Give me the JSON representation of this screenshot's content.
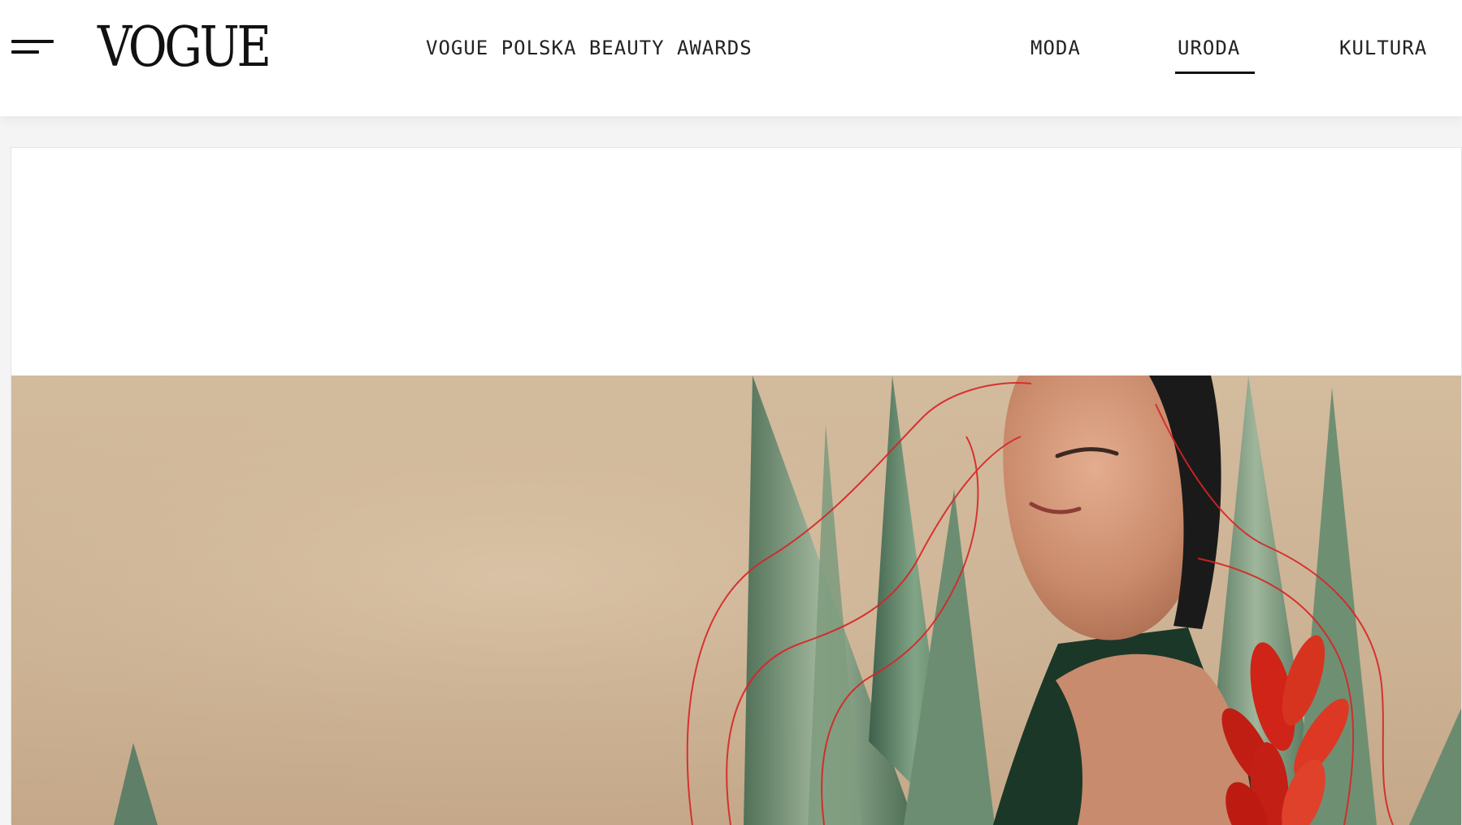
{
  "header": {
    "logo_text": "VOGUE",
    "menu_icon": "hamburger-menu-icon",
    "nav": [
      {
        "label": "VOGUE POLSKA BEAUTY AWARDS",
        "active": false
      },
      {
        "label": "MODA",
        "active": false
      },
      {
        "label": "URODA",
        "active": true
      },
      {
        "label": "KULTURA",
        "active": false
      }
    ]
  },
  "hero": {
    "image_subject": "woman-with-closed-eyes-among-snake-plants",
    "accent_colors": {
      "background": "#d8c1a4",
      "leaf": "#5c7b63",
      "red_line": "#d72525",
      "flower": "#c91f14",
      "dress": "#1b3728"
    }
  },
  "colors": {
    "page_background": "#f4f4f4",
    "header_background": "#ffffff",
    "text": "#222222"
  }
}
